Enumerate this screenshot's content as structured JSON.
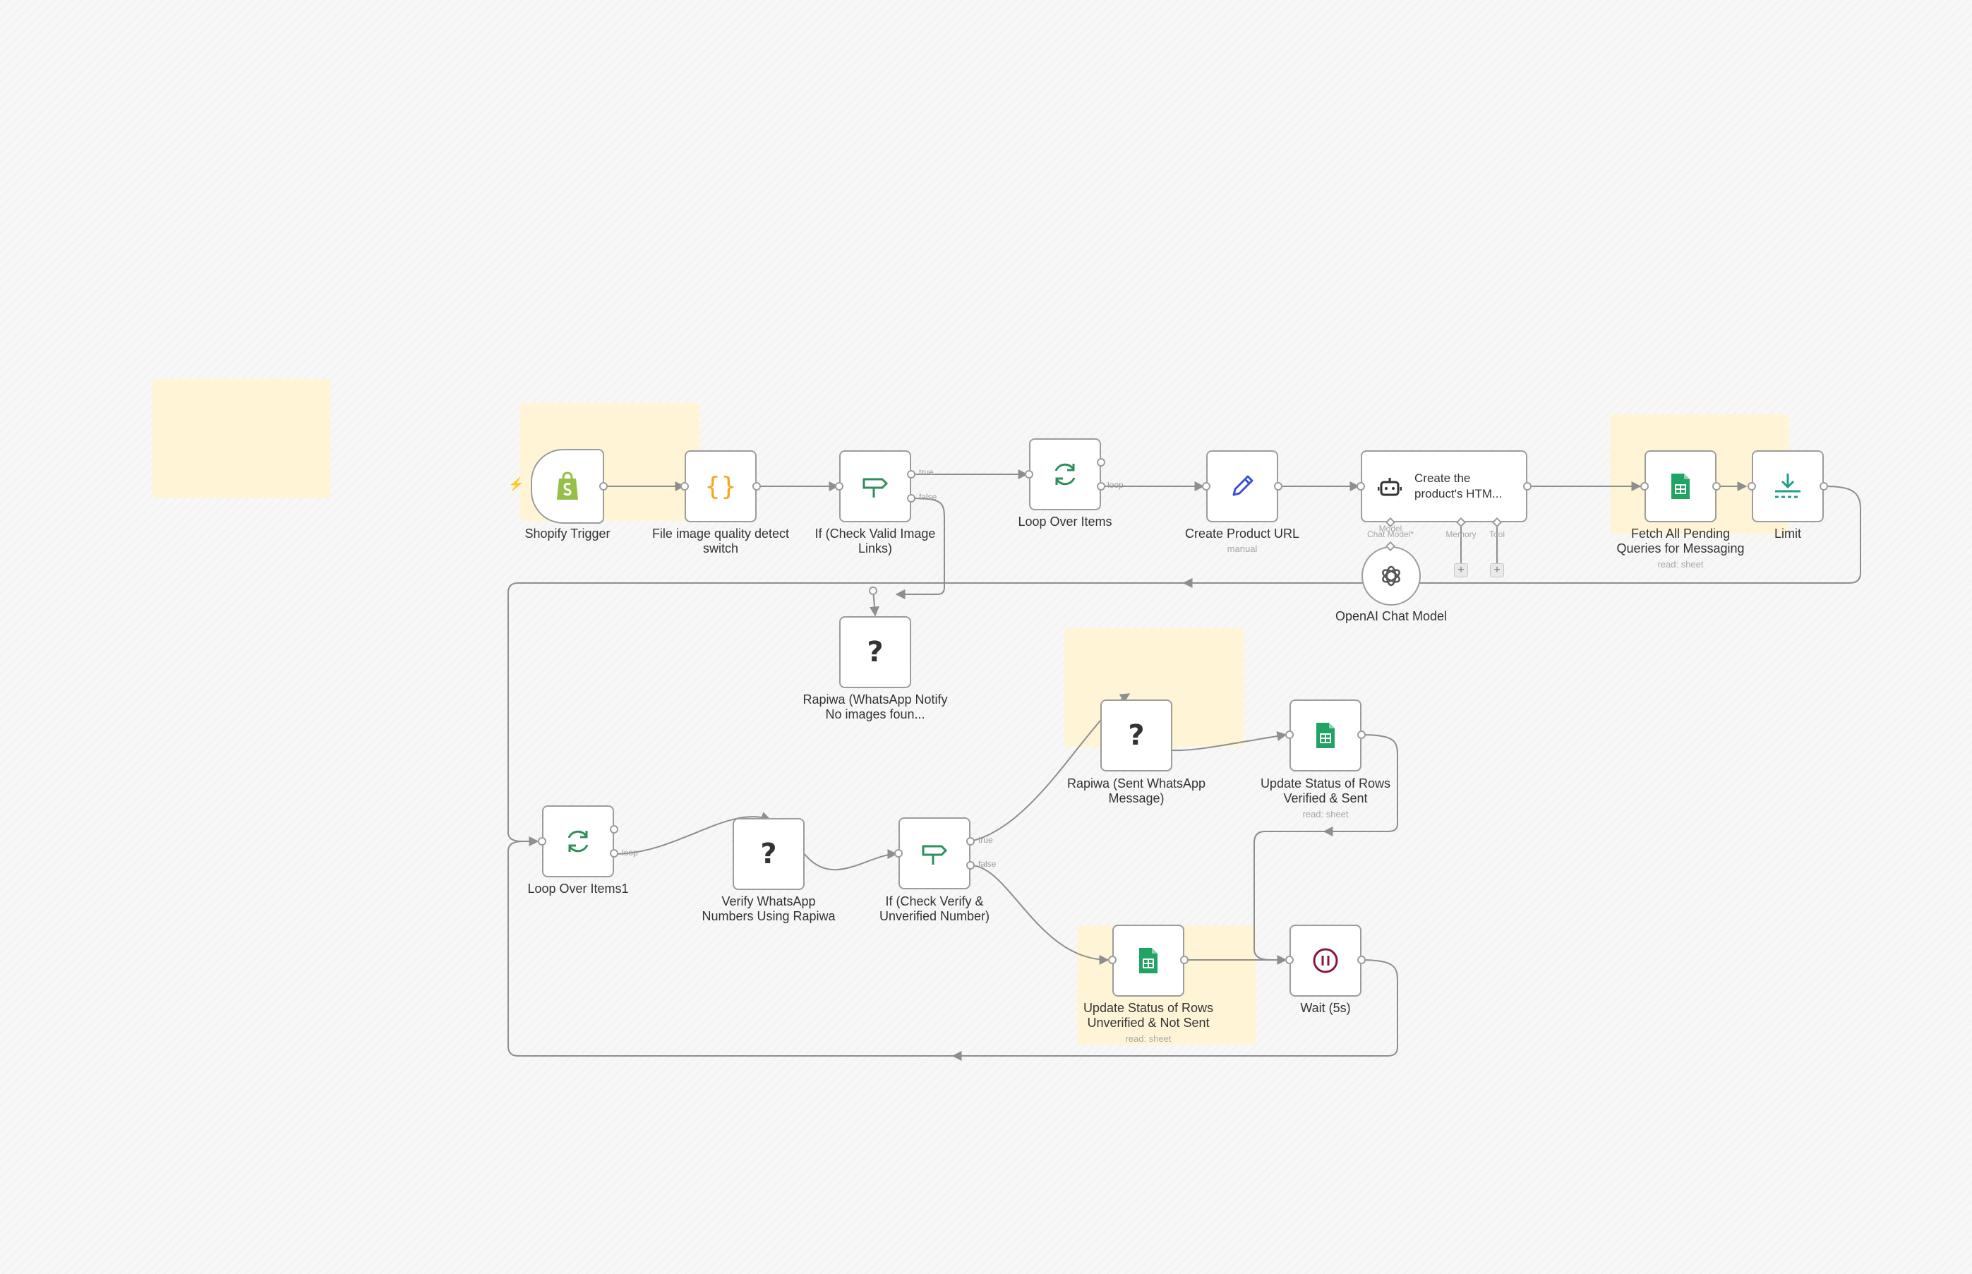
{
  "trigger_bolt": "⚡",
  "nodes": {
    "shopify_trigger": {
      "label": "Shopify Trigger",
      "icon": "shopify-icon"
    },
    "file_image_quality": {
      "label": "File image quality detect switch",
      "icon": "code-braces-icon"
    },
    "if_check_valid_image": {
      "label": "If (Check Valid Image Links)",
      "icon": "signpost-icon"
    },
    "loop_over_items": {
      "label": "Loop Over Items",
      "icon": "loop-arrows-icon"
    },
    "create_product_url": {
      "label": "Create Product URL",
      "subtitle": "manual",
      "icon": "pencil-icon"
    },
    "create_html_agent": {
      "title": "Create the product's HTM...",
      "icon": "robot-icon"
    },
    "fetch_all_pending": {
      "label": "Fetch All Pending Queries for Messaging",
      "subtitle": "read: sheet",
      "icon": "google-sheets-icon"
    },
    "limit": {
      "label": "Limit",
      "icon": "limit-download-icon"
    },
    "openai_chat_model": {
      "label": "OpenAI Chat Model",
      "icon": "openai-icon"
    },
    "rapiwa_notify_no_images": {
      "label": "Rapiwa (WhatsApp Notify No images foun...",
      "icon": "question-mark-icon",
      "glyph": "?"
    },
    "loop_over_items1": {
      "label": "Loop Over Items1",
      "icon": "loop-arrows-icon"
    },
    "verify_whatsapp": {
      "label": "Verify WhatsApp Numbers Using Rapiwa",
      "icon": "question-mark-icon",
      "glyph": "?"
    },
    "if_check_verify": {
      "label": "If (Check Verify & Unverified Number)",
      "icon": "signpost-icon"
    },
    "rapiwa_sent": {
      "label": "Rapiwa (Sent WhatsApp Message)",
      "icon": "question-mark-icon",
      "glyph": "?"
    },
    "update_verified_sent": {
      "label": "Update Status of Rows Verified & Sent",
      "subtitle": "read: sheet",
      "icon": "google-sheets-icon"
    },
    "update_unverified_not_sent": {
      "label": "Update Status of Rows Unverified & Not Sent",
      "subtitle": "read: sheet",
      "icon": "google-sheets-icon"
    },
    "wait_5s": {
      "label": "Wait (5s)",
      "icon": "pause-icon"
    }
  },
  "edge_labels": {
    "true": "true",
    "false": "false",
    "loop": "loop"
  },
  "agent_slots": {
    "chat_model": "Chat Model*",
    "memory": "Memory",
    "tool": "Tool",
    "model": "Model",
    "add": "+"
  },
  "colors": {
    "canvas_background": "#f7f7f7",
    "sticky_note": "#fff5d6",
    "node_border": "#9c9c9c",
    "edge": "#8e8e8e",
    "shopify_green": "#95bf47",
    "code_orange": "#f5a623",
    "if_green": "#2f8f5b",
    "loop_green": "#2f8f5b",
    "pencil_blue": "#3b4fd8",
    "sheets_green": "#1fa463",
    "wait_maroon": "#8a1538",
    "trigger_bolt": "#ff6d5a"
  }
}
